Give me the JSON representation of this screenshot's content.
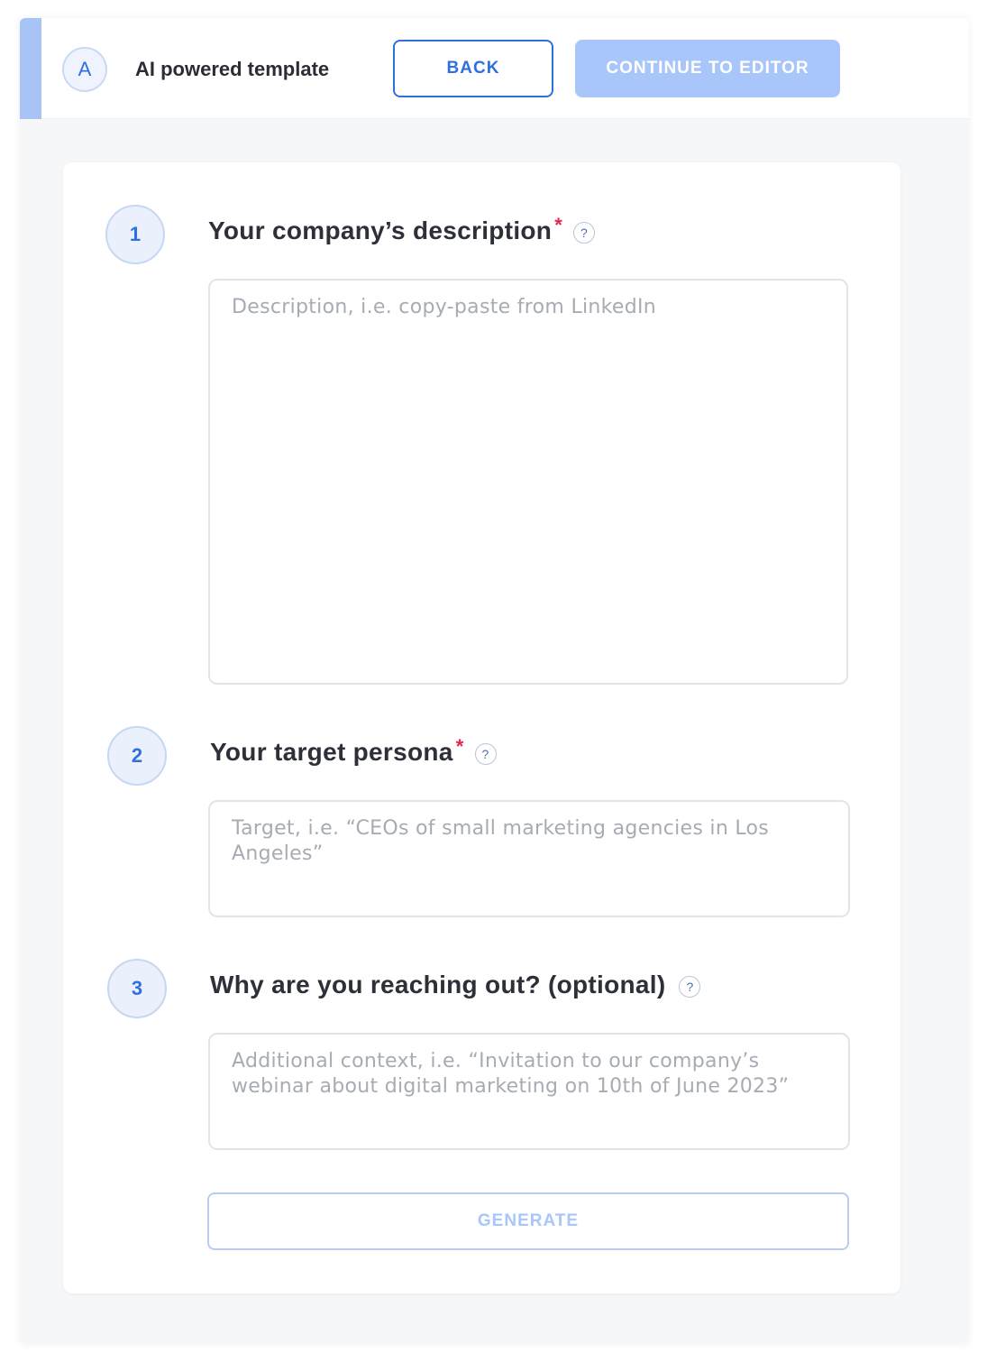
{
  "colors": {
    "accent": "#2f6fdf",
    "accent_light": "#a9c6fb",
    "accent_bar": "#a8c4f6"
  },
  "header": {
    "avatar_letter": "A",
    "title": "AI powered template",
    "back_label": "BACK",
    "continue_label": "CONTINUE TO EDITOR"
  },
  "steps": [
    {
      "number": "1",
      "title": "Your company’s description",
      "required": "*",
      "help": "?",
      "placeholder": "Description, i.e. copy-paste from LinkedIn",
      "value": ""
    },
    {
      "number": "2",
      "title": "Your target persona",
      "required": "*",
      "help": "?",
      "placeholder": "Target, i.e. “CEOs of small marketing agencies in Los Angeles”",
      "value": ""
    },
    {
      "number": "3",
      "title": "Why are you reaching out? (optional)",
      "required": "",
      "help": "?",
      "placeholder": "Additional context, i.e. “Invitation to our company’s webinar about digital marketing on 10th of June 2023”",
      "value": ""
    }
  ],
  "generate_label": "GENERATE"
}
